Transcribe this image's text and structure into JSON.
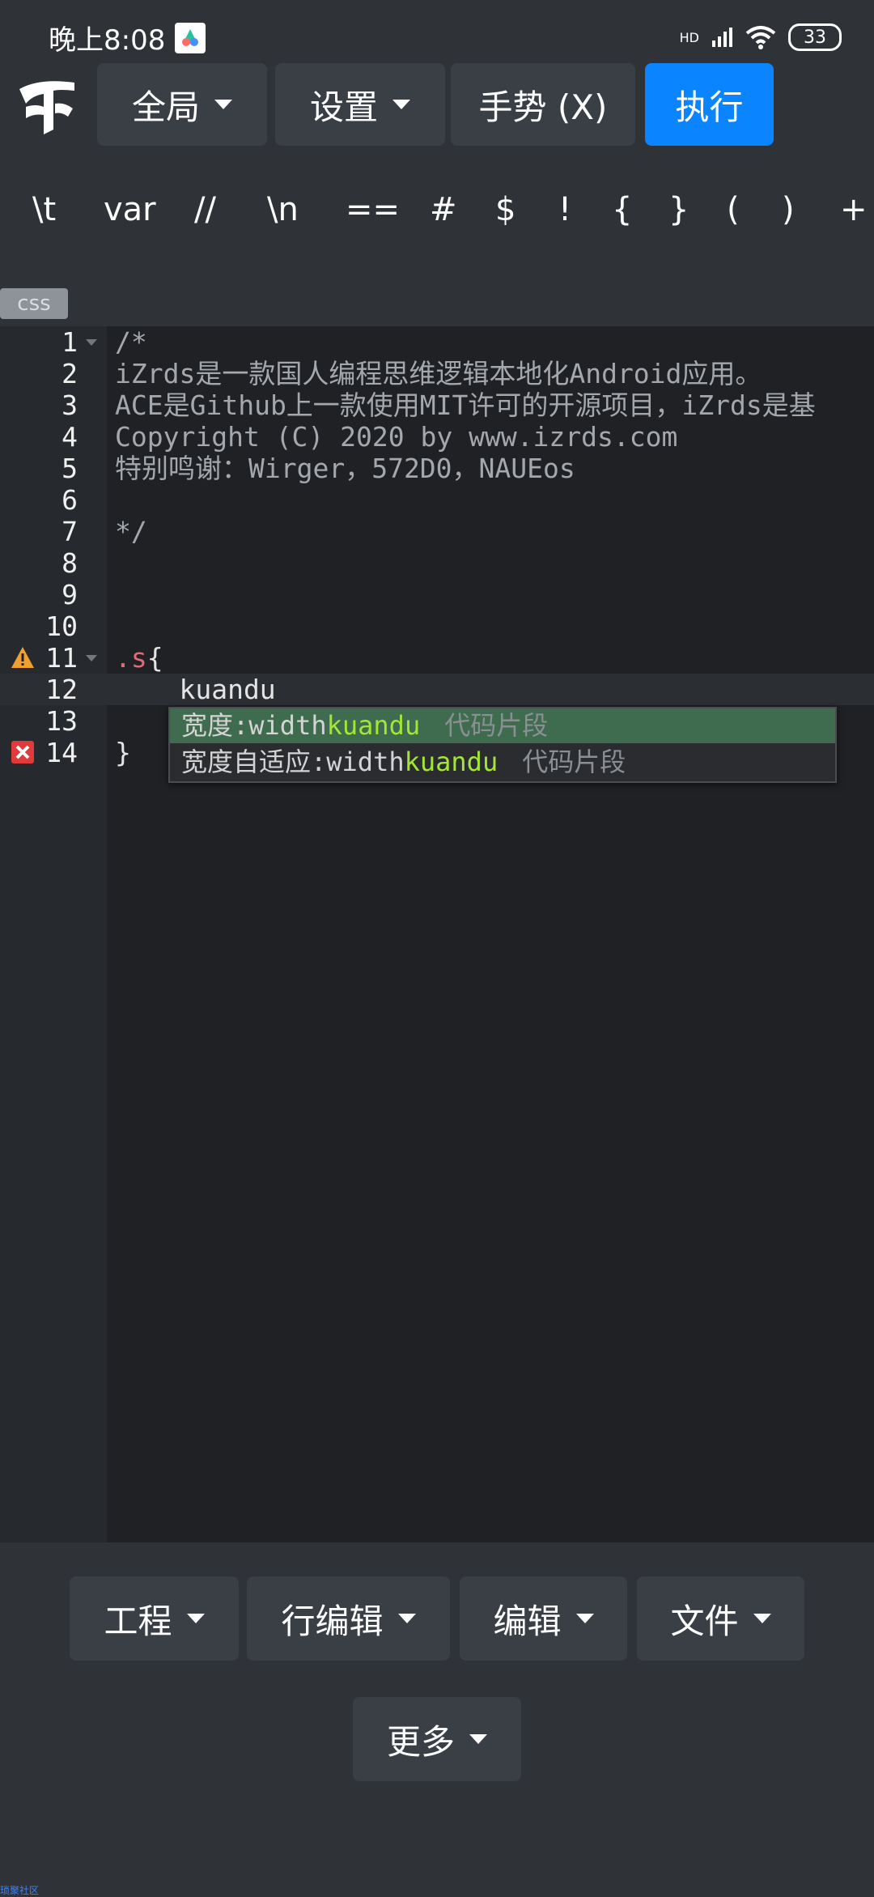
{
  "status": {
    "time": "晚上8:08",
    "network_label": "HD",
    "battery": "33"
  },
  "toolbar": {
    "global_label": "全局",
    "settings_label": "设置",
    "gesture_label": "手势 (X)",
    "run_label": "执行"
  },
  "symbols": [
    "\\t",
    "var",
    "//",
    "\\n",
    "==",
    "#",
    "$",
    "!",
    "{",
    "}",
    "(",
    ")",
    "+"
  ],
  "editor": {
    "mode": "css",
    "lines": [
      {
        "num": "1",
        "text": "/*"
      },
      {
        "num": "2",
        "text": "iZrds是一款国人编程思维逻辑本地化Android应用。"
      },
      {
        "num": "3",
        "text": "ACE是Github上一款使用MIT许可的开源项目，iZrds是基"
      },
      {
        "num": "4",
        "text": "Copyright (C) 2020 by www.izrds.com"
      },
      {
        "num": "5",
        "text": "特别鸣谢：Wirger，572D0，NAUEos"
      },
      {
        "num": "6",
        "text": ""
      },
      {
        "num": "7",
        "text": "*/"
      },
      {
        "num": "8",
        "text": ""
      },
      {
        "num": "9",
        "text": ""
      },
      {
        "num": "10",
        "text": ""
      },
      {
        "num": "11",
        "text": ".s{"
      },
      {
        "num": "12",
        "text": "    kuandu"
      },
      {
        "num": "13",
        "text": ""
      },
      {
        "num": "14",
        "text": "}"
      }
    ]
  },
  "autocomplete": {
    "items": [
      {
        "prefix": "宽度:width",
        "match": "kuandu",
        "meta": "代码片段"
      },
      {
        "prefix": "宽度自适应:width",
        "match": "kuandu",
        "meta": "代码片段"
      }
    ]
  },
  "bottom": {
    "project_label": "工程",
    "line_edit_label": "行编辑",
    "edit_label": "编辑",
    "file_label": "文件",
    "more_label": "更多"
  },
  "footer": {
    "corner_text": "琐聚社区"
  }
}
